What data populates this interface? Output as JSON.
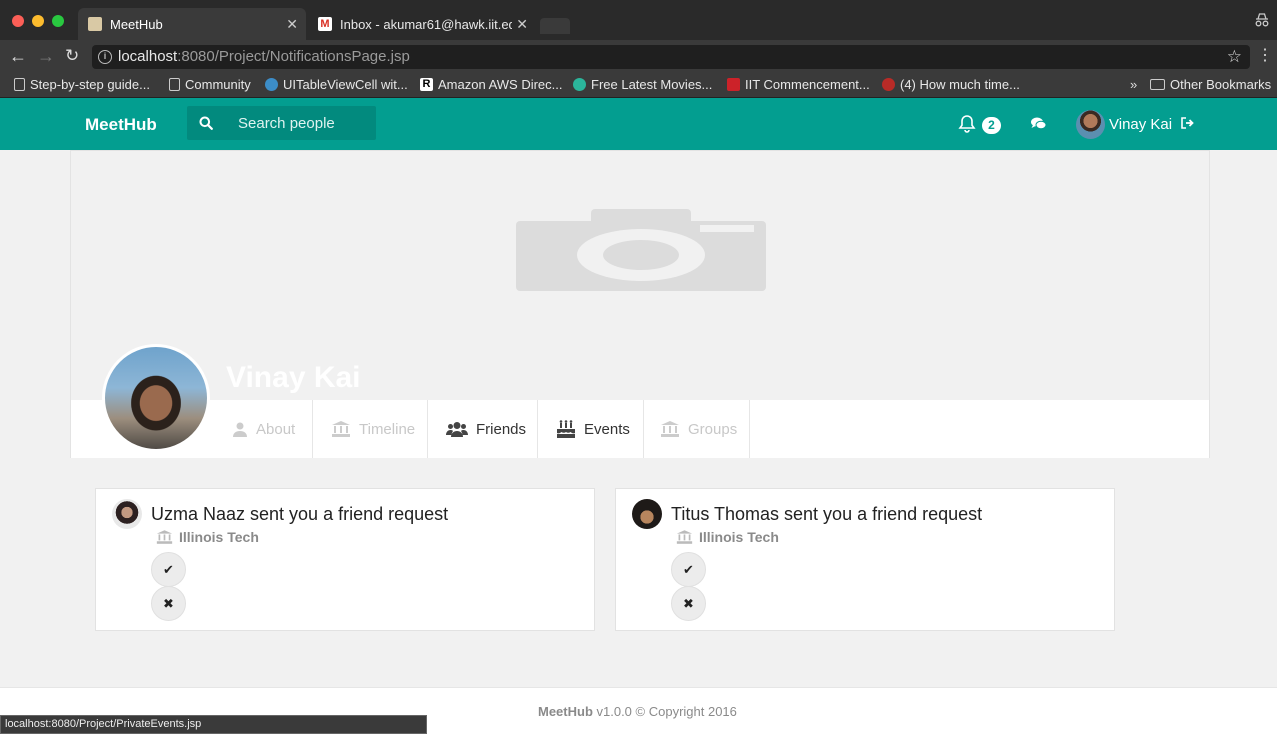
{
  "browser": {
    "tabs": [
      {
        "title": "MeetHub"
      },
      {
        "title": "Inbox - akumar61@hawk.iit.ed"
      }
    ],
    "url_host": "localhost",
    "url_rest": ":8080/Project/NotificationsPage.jsp",
    "bookmarks": [
      "Step-by-step guide...",
      "Community",
      "UITableViewCell wit...",
      "Amazon AWS Direc...",
      "Free Latest Movies...",
      "IIT Commencement...",
      "(4) How much time...",
      "Other Bookmarks"
    ],
    "overflow_chevron": "»",
    "status_url": "localhost:8080/Project/PrivateEvents.jsp"
  },
  "app": {
    "brand": "MeetHub",
    "search_placeholder": "Search people",
    "notification_count": "2",
    "username": "Vinay Kai",
    "accent": "#039e90"
  },
  "profile": {
    "name": "Vinay Kai",
    "nav": [
      "About",
      "Timeline",
      "Friends",
      "Events",
      "Groups"
    ]
  },
  "notifications": [
    {
      "text": "Uzma Naaz sent you a friend request",
      "org": "Illinois Tech"
    },
    {
      "text": "Titus Thomas sent you a friend request",
      "org": "Illinois Tech"
    }
  ],
  "footer": {
    "brand": "MeetHub",
    "rest": " v1.0.0 © Copyright 2016"
  }
}
